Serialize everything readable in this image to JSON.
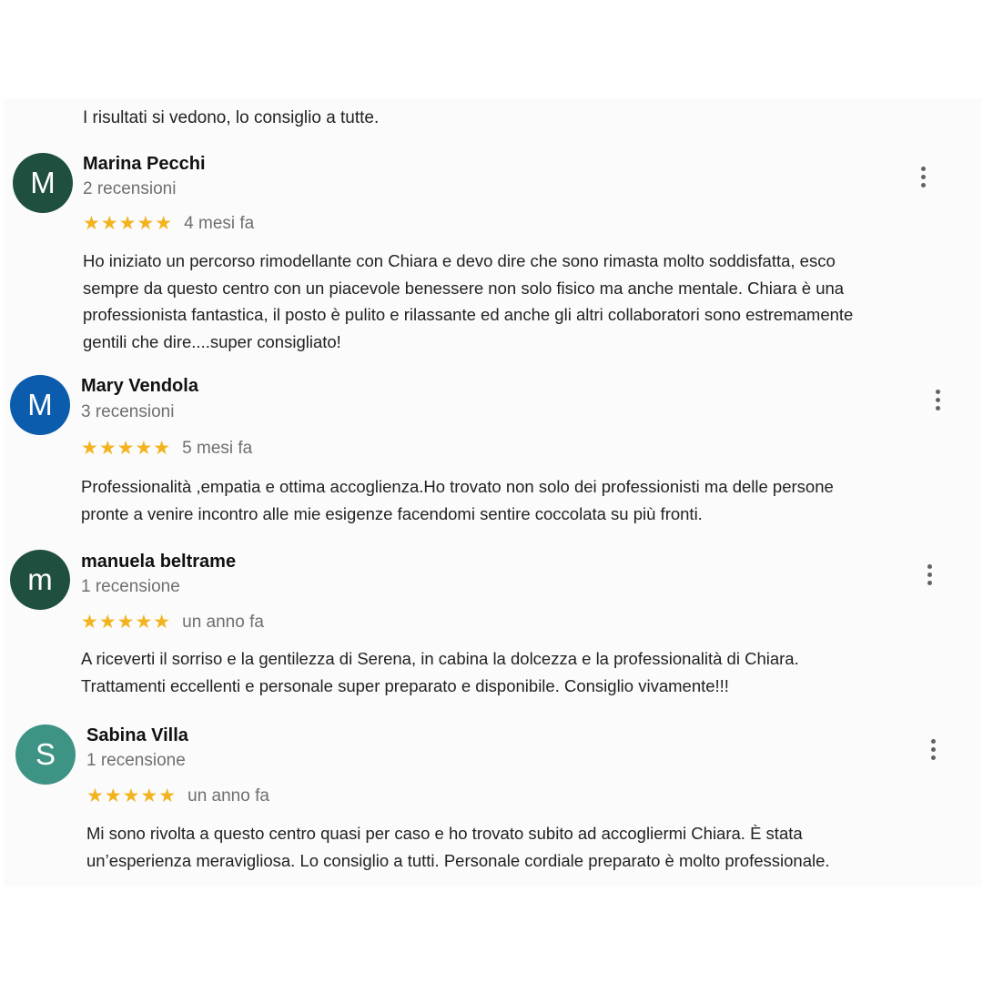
{
  "intro_text": "I risultati si vedono, lo consiglio a tutte.",
  "colors": {
    "star": "#f2b31e"
  },
  "reviews": [
    {
      "initial": "M",
      "avatar_color": "#1f4f3f",
      "name": "Marina Pecchi",
      "review_count": "2 recensioni",
      "stars": "★★★★★",
      "rating": 5,
      "time": "4 mesi fa",
      "lines": [
        "Ho iniziato un percorso rimodellante con Chiara e devo dire che sono rimasta molto soddisfatta, esco",
        "sempre da questo centro con un piacevole benessere non solo fisico ma anche mentale. Chiara è una",
        "professionista fantastica, il posto è pulito e rilassante ed anche gli altri collaboratori sono estremamente",
        "gentili che dire....super consigliato!"
      ]
    },
    {
      "initial": "M",
      "avatar_color": "#0b5cad",
      "name": "Mary Vendola",
      "review_count": "3 recensioni",
      "stars": "★★★★★",
      "rating": 5,
      "time": "5 mesi fa",
      "lines": [
        "Professionalità ,empatia e ottima accoglienza.Ho trovato non solo dei professionisti ma delle persone",
        "pronte a venire incontro alle mie esigenze facendomi sentire coccolata su più fronti."
      ]
    },
    {
      "initial": "m",
      "avatar_color": "#1f4f3f",
      "name": "manuela beltrame",
      "review_count": "1 recensione",
      "stars": "★★★★★",
      "rating": 5,
      "time": "un anno fa",
      "lines": [
        "A riceverti il sorriso e la gentilezza di Serena, in cabina la dolcezza e la professionalità di Chiara.",
        "Trattamenti eccellenti e personale super preparato e disponibile. Consiglio vivamente!!!"
      ]
    },
    {
      "initial": "S",
      "avatar_color": "#3e9484",
      "name": "Sabina Villa",
      "review_count": "1 recensione",
      "stars": "★★★★★",
      "rating": 5,
      "time": "un anno fa",
      "lines": [
        "Mi sono rivolta a questo centro quasi per caso e ho trovato subito ad accogliermi Chiara. È stata",
        "un’esperienza meravigliosa. Lo consiglio a tutti. Personale cordiale preparato è molto professionale."
      ]
    }
  ]
}
